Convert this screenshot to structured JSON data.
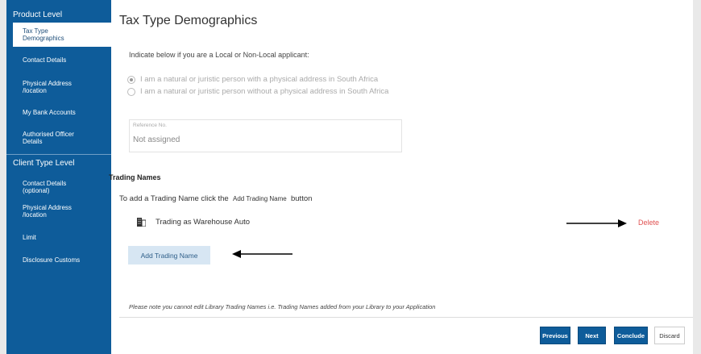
{
  "sidebar": {
    "product_level": {
      "heading": "Product Level",
      "items": [
        {
          "label": "Tax Type Demographics"
        },
        {
          "label": "Contact Details"
        },
        {
          "label": "Physical Address /location"
        },
        {
          "label": "My Bank Accounts"
        },
        {
          "label": "Authorised Officer Details"
        }
      ]
    },
    "client_level": {
      "heading": "Client Type Level",
      "items": [
        {
          "label": "Contact Details (optional)"
        },
        {
          "label": "Physical Address /location"
        },
        {
          "label": "Limit"
        },
        {
          "label": "Disclosure Customs"
        }
      ]
    }
  },
  "main": {
    "title": "Tax Type Demographics",
    "intro": "Indicate below if you are a Local or Non-Local applicant:",
    "radio_options": [
      {
        "label": "I am a natural or juristic person with a physical address in South Africa",
        "checked": true
      },
      {
        "label": "I am a natural or juristic person without a physical address in South Africa",
        "checked": false
      }
    ],
    "reference": {
      "label": "Reference No.",
      "value": "Not assigned"
    },
    "trading_names": {
      "title": "Trading Names",
      "instruction_prefix": "To add a Trading Name click the",
      "instruction_button": "Add Trading Name",
      "instruction_suffix": "button",
      "items": [
        {
          "name": "Trading as Warehouse Auto",
          "icon": "building-icon"
        }
      ],
      "delete_label": "Delete",
      "add_button": "Add Trading Name"
    },
    "note": "Please note  you cannot edit Library Trading Names i.e. Trading Names added from your Library to your Application"
  },
  "footer": {
    "previous": "Previous",
    "next": "Next",
    "conclude": "Conclude",
    "discard": "Discard"
  },
  "colors": {
    "sidebar": "#0e5c9a",
    "delete": "#e05252",
    "add_button_bg": "#d7e6f3"
  }
}
